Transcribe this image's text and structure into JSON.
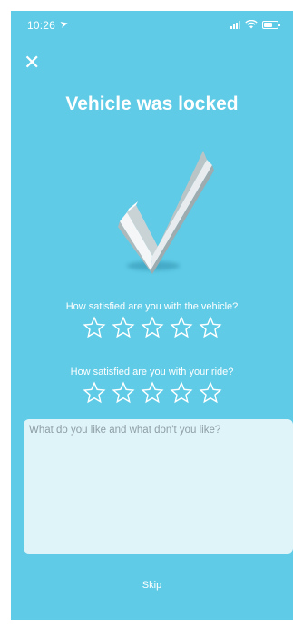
{
  "status_bar": {
    "time": "10:26",
    "location_icon": "location-arrow-icon",
    "icons": [
      "signal-icon",
      "wifi-icon",
      "battery-icon"
    ]
  },
  "header": {
    "close_icon": "close-icon",
    "close_label": "✕",
    "title": "Vehicle was locked"
  },
  "hero": {
    "icon": "checkmark-icon"
  },
  "ratings": [
    {
      "question": "How satisfied are you with the vehicle?",
      "rating": 0,
      "max": 5
    },
    {
      "question": "How satisfied are you with your ride?",
      "rating": 0,
      "max": 5
    }
  ],
  "feedback": {
    "placeholder": "What do you like and what don't you like?",
    "value": ""
  },
  "footer": {
    "skip_label": "Skip"
  },
  "colors": {
    "background": "#5fcbe6",
    "text": "#ffffff",
    "input_bg": "#dff4f9",
    "placeholder": "#8e9ea5"
  }
}
